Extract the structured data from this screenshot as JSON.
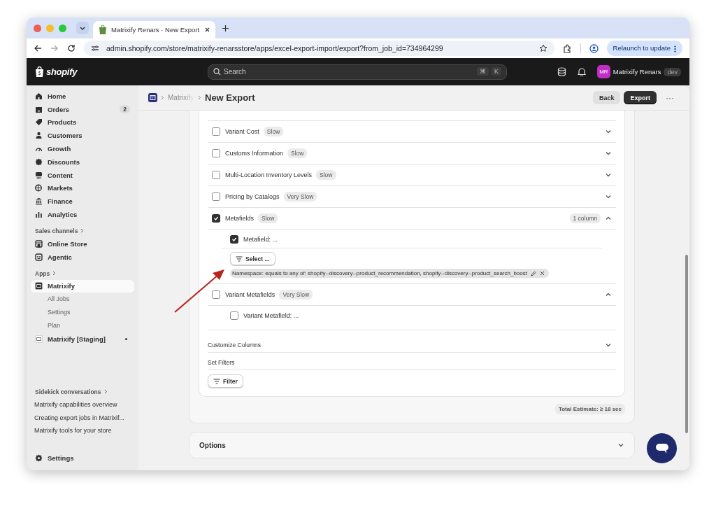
{
  "browser": {
    "tabs": [
      {
        "title": "Matrixify Renars · New Export",
        "selected": true
      }
    ],
    "url": "admin.shopify.com/store/matrixify-renarsstore/apps/excel-export-import/export?from_job_id=734964299",
    "relaunch_button": "Relaunch to update"
  },
  "topbar": {
    "logo": "shopify",
    "search": {
      "placeholder": "Search",
      "shortcut": [
        "⌘",
        "K"
      ]
    },
    "user": {
      "initials": "MR",
      "name": "Matrixify Renars",
      "badge": "dev"
    }
  },
  "sidebar": {
    "items": [
      {
        "label": "Home",
        "selected": false
      },
      {
        "label": "Orders",
        "badge": "2",
        "selected": false
      },
      {
        "label": "Products",
        "selected": false
      },
      {
        "label": "Customers",
        "selected": false
      },
      {
        "label": "Growth",
        "selected": false
      },
      {
        "label": "Discounts",
        "selected": false
      },
      {
        "label": "Content",
        "selected": false
      },
      {
        "label": "Markets",
        "selected": false
      },
      {
        "label": "Finance",
        "selected": false
      },
      {
        "label": "Analytics",
        "selected": false
      }
    ],
    "sales_channels": {
      "heading": "Sales channels",
      "items": [
        {
          "label": "Online Store",
          "selected": false
        },
        {
          "label": "Agentic",
          "selected": false
        }
      ]
    },
    "apps": {
      "heading": "Apps",
      "items": [
        {
          "label": "Matrixify",
          "selected": true,
          "children": [
            {
              "label": "All Jobs"
            },
            {
              "label": "Settings"
            },
            {
              "label": "Plan"
            }
          ]
        },
        {
          "label": "Matrixify [Staging]",
          "dot": true,
          "selected": false
        }
      ]
    },
    "sidekick": {
      "heading": "Sidekick conversations",
      "items": [
        {
          "label": "Matrixify capabilities overview"
        },
        {
          "label": "Creating export jobs in Matrixif..."
        },
        {
          "label": "Matrixify tools for your store"
        }
      ]
    },
    "settings": "Settings"
  },
  "header": {
    "breadcrumb": "Matrixify",
    "title": "New Export",
    "buttons": [
      {
        "label": "Back",
        "kind": "secondary"
      },
      {
        "label": "Export",
        "kind": "primary"
      }
    ],
    "more": "···"
  },
  "sections": [
    {
      "label": "Variant Cost",
      "speed": "Slow",
      "checked": false,
      "expanded": false
    },
    {
      "label": "Customs Information",
      "speed": "Slow",
      "checked": false,
      "expanded": false
    },
    {
      "label": "Multi-Location Inventory Levels",
      "speed": "Slow",
      "checked": false,
      "expanded": false
    },
    {
      "label": "Pricing by Catalogs",
      "speed": "Very Slow",
      "checked": false,
      "expanded": false
    },
    {
      "label": "Metafields",
      "speed": "Slow",
      "count": "1 column",
      "checked": true,
      "expanded": true,
      "children": [
        {
          "label": "Metafield: ...",
          "checked": true
        }
      ],
      "select_button": "Select ...",
      "filter_chip": "Namespace: equals to any of: shopify--discovery--product_recommendation, shopify--discovery--product_search_boost"
    },
    {
      "label": "Variant Metafields",
      "speed": "Very Slow",
      "checked": false,
      "expanded": true,
      "children": [
        {
          "label": "Variant Metafield: ...",
          "checked": false
        }
      ]
    }
  ],
  "customize_columns": {
    "label": "Customize Columns",
    "expanded": false
  },
  "set_filters": {
    "label": "Set Filters",
    "button": "Filter"
  },
  "total_estimate": "Total Estimate: ≥ 18 sec",
  "options": {
    "label": "Options",
    "expanded": false
  }
}
